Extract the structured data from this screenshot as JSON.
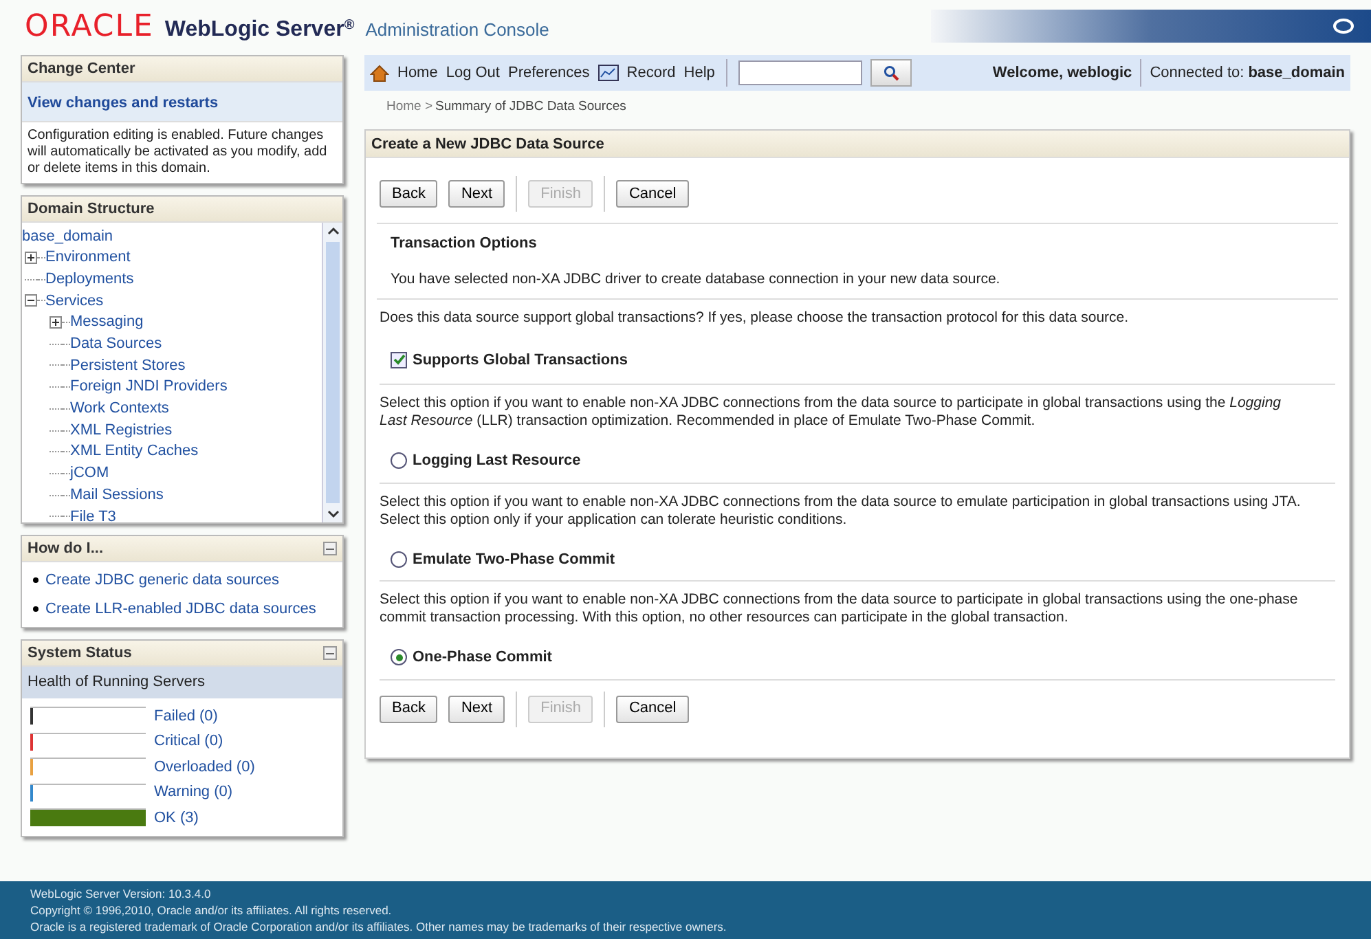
{
  "header": {
    "brand": "ORACLE",
    "product": "WebLogic Server",
    "product_mark": "®",
    "console": "Administration Console"
  },
  "toolbar": {
    "links": [
      "Home",
      "Log Out",
      "Preferences",
      "Record",
      "Help"
    ],
    "welcome": "Welcome, weblogic",
    "connected_label": "Connected to:",
    "connected_value": "base_domain"
  },
  "breadcrumb": {
    "home": "Home >",
    "current": "Summary of JDBC Data Sources"
  },
  "change_center": {
    "title": "Change Center",
    "link": "View changes and restarts",
    "text": "Configuration editing is enabled. Future changes will automatically be activated as you modify, add or delete items in this domain."
  },
  "domain_structure": {
    "title": "Domain Structure",
    "root": "base_domain",
    "tree": [
      {
        "label": "Environment",
        "expanded": false
      },
      {
        "label": "Deployments"
      },
      {
        "label": "Services",
        "expanded": true,
        "children": [
          {
            "label": "Messaging",
            "expanded": false
          },
          {
            "label": "Data Sources"
          },
          {
            "label": "Persistent Stores"
          },
          {
            "label": "Foreign JNDI Providers"
          },
          {
            "label": "Work Contexts"
          },
          {
            "label": "XML Registries"
          },
          {
            "label": "XML Entity Caches"
          },
          {
            "label": "jCOM"
          },
          {
            "label": "Mail Sessions"
          },
          {
            "label": "File T3"
          }
        ]
      }
    ]
  },
  "how_do_i": {
    "title": "How do I...",
    "links": [
      "Create JDBC generic data sources",
      "Create LLR-enabled JDBC data sources"
    ]
  },
  "system_status": {
    "title": "System Status",
    "subtitle": "Health of Running Servers",
    "rows": [
      {
        "label": "Failed (0)",
        "color": "#333333",
        "level": 0
      },
      {
        "label": "Critical (0)",
        "color": "#dd3333",
        "level": 0
      },
      {
        "label": "Overloaded (0)",
        "color": "#e8a040",
        "level": 0
      },
      {
        "label": "Warning (0)",
        "color": "#3388cc",
        "level": 0
      },
      {
        "label": "OK (3)",
        "color": "#4a7a10",
        "level": 1
      }
    ]
  },
  "panel": {
    "title": "Create a New JDBC Data Source",
    "buttons_top": [
      {
        "label": "Back",
        "disabled": false
      },
      {
        "label": "Next",
        "disabled": false
      },
      {
        "label": "Finish",
        "disabled": true
      },
      {
        "label": "Cancel",
        "disabled": false
      }
    ],
    "section_title": "Transaction Options",
    "section_intro": "You have selected non-XA JDBC driver to create database connection in your new data source.",
    "items": [
      {
        "kind": "text",
        "text": "Does this data source support global transactions? If yes, please choose the transaction protocol for this data source."
      },
      {
        "kind": "checkbox",
        "label": "Supports Global Transactions",
        "checked": true
      },
      {
        "kind": "text",
        "text": "Select this option if you want to enable non-XA JDBC connections from the data source to participate in global transactions using the *Logging Last Resource* (LLR) transaction optimization. Recommended in place of Emulate Two-Phase Commit."
      },
      {
        "kind": "radio",
        "label": "Logging Last Resource",
        "selected": false
      },
      {
        "kind": "text",
        "text": "Select this option if you want to enable non-XA JDBC connections from the data source to emulate participation in global transactions using JTA. Select this option only if your application can tolerate heuristic conditions."
      },
      {
        "kind": "radio",
        "label": "Emulate Two-Phase Commit",
        "selected": false
      },
      {
        "kind": "text",
        "text": "Select this option if you want to enable non-XA JDBC connections from the data source to participate in global transactions using the one-phase commit transaction processing. With this option, no other resources can participate in the global transaction."
      },
      {
        "kind": "radio",
        "label": "One-Phase Commit",
        "selected": true
      }
    ],
    "buttons_bottom": [
      {
        "label": "Back",
        "disabled": false
      },
      {
        "label": "Next",
        "disabled": false
      },
      {
        "label": "Finish",
        "disabled": true
      },
      {
        "label": "Cancel",
        "disabled": false
      }
    ]
  },
  "footer": [
    "WebLogic Server Version: 10.3.4.0",
    "Copyright © 1996,2010, Oracle and/or its affiliates. All rights reserved.",
    "Oracle is a registered trademark of Oracle Corporation and/or its affiliates. Other names may be trademarks of their respective owners."
  ]
}
